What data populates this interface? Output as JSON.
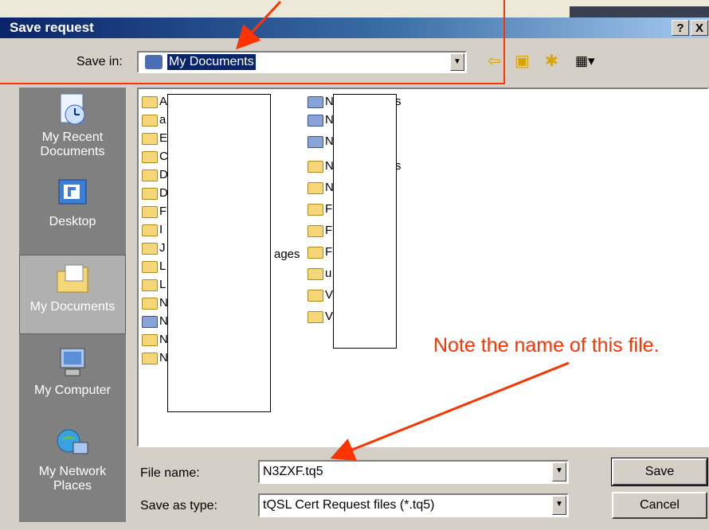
{
  "dialog": {
    "title": "Save request",
    "help_label": "?",
    "close_label": "X"
  },
  "save_in": {
    "label": "Save in:",
    "value": "My Documents"
  },
  "places": [
    {
      "label": "My Recent Documents",
      "icon": "recent-documents-icon"
    },
    {
      "label": "Desktop",
      "icon": "desktop-icon"
    },
    {
      "label": "My Documents",
      "icon": "my-documents-icon"
    },
    {
      "label": "My Computer",
      "icon": "my-computer-icon"
    },
    {
      "label": "My Network Places",
      "icon": "network-places-icon"
    }
  ],
  "files_left": [
    "A",
    "a",
    "E",
    "C",
    "D",
    "D",
    "F",
    "I",
    "J",
    "L",
    "L",
    "N",
    "N",
    "N",
    "N"
  ],
  "files_left_partial": {
    "ages": "ages"
  },
  "files_right": [
    "N",
    "N",
    "N",
    "N",
    "N",
    "F",
    "F",
    "F",
    "u",
    "V",
    "V"
  ],
  "files_right_partial": {
    "s1": "s",
    "s2": "s"
  },
  "file_name": {
    "label": "File name:",
    "value": "N3ZXF.tq5"
  },
  "save_as_type": {
    "label": "Save as type:",
    "value": "tQSL Cert Request files (*.tq5)"
  },
  "buttons": {
    "save": "Save",
    "cancel": "Cancel"
  },
  "annotation": {
    "note": "Note the name of this file.",
    "color": "#ff3300"
  }
}
